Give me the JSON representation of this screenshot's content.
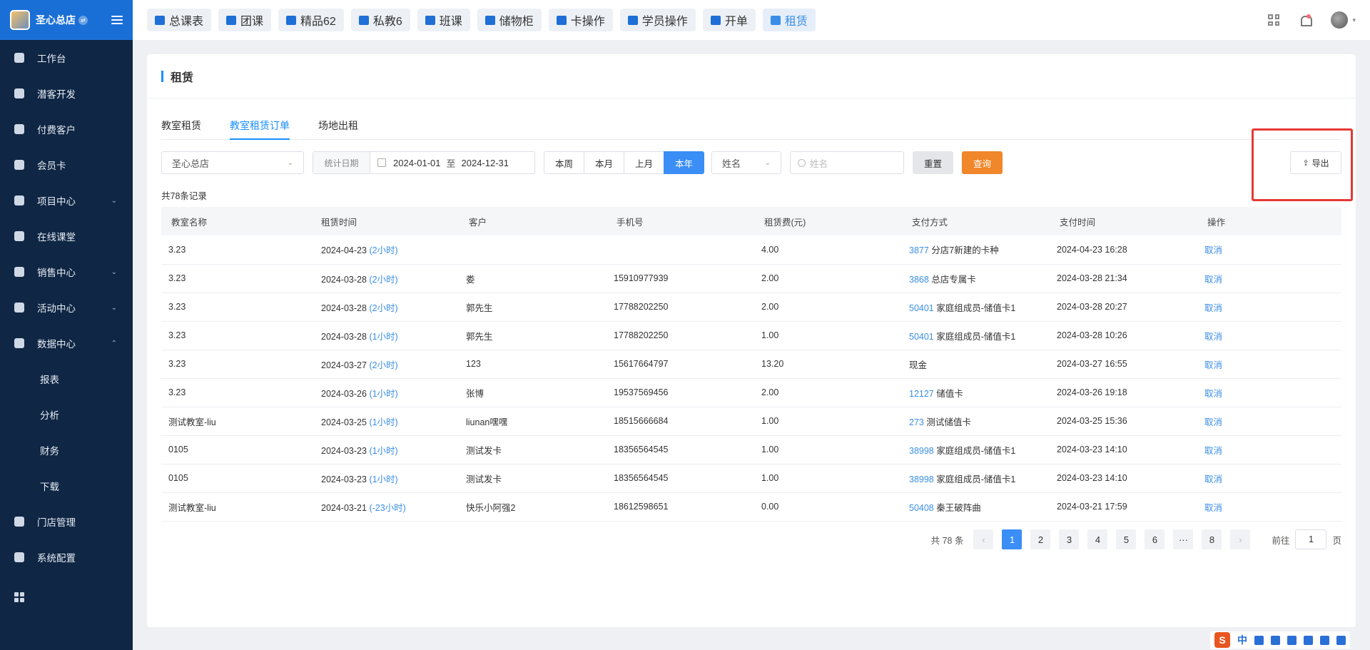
{
  "brand": {
    "name": "圣心总店"
  },
  "sidebar": {
    "items": [
      {
        "label": "工作台",
        "icon": "desktop-icon",
        "arrow": ""
      },
      {
        "label": "潜客开发",
        "icon": "contact-card-icon",
        "arrow": ""
      },
      {
        "label": "付费客户",
        "icon": "users-icon",
        "arrow": ""
      },
      {
        "label": "会员卡",
        "icon": "card-icon",
        "arrow": ""
      },
      {
        "label": "项目中心",
        "icon": "project-icon",
        "arrow": "⌄"
      },
      {
        "label": "在线课堂",
        "icon": "video-icon",
        "arrow": ""
      },
      {
        "label": "销售中心",
        "icon": "tag-icon",
        "arrow": "⌄"
      },
      {
        "label": "活动中心",
        "icon": "gift-icon",
        "arrow": "⌄"
      },
      {
        "label": "数据中心",
        "icon": "pie-chart-icon",
        "arrow": "⌃"
      },
      {
        "label": "报表",
        "sub": true
      },
      {
        "label": "分析",
        "sub": true
      },
      {
        "label": "财务",
        "sub": true
      },
      {
        "label": "下载",
        "sub": true
      },
      {
        "label": "门店管理",
        "icon": "store-icon",
        "arrow": ""
      },
      {
        "label": "系统配置",
        "icon": "settings-icon",
        "arrow": ""
      }
    ]
  },
  "topbar": {
    "tabs": [
      {
        "label": "总课表",
        "icon": "book-icon"
      },
      {
        "label": "团课",
        "icon": "book-icon"
      },
      {
        "label": "精品62",
        "icon": "star-icon"
      },
      {
        "label": "私教6",
        "icon": "users-icon"
      },
      {
        "label": "班课",
        "icon": "board-icon"
      },
      {
        "label": "储物柜",
        "icon": "locker-icon"
      },
      {
        "label": "卡操作",
        "icon": "card-icon"
      },
      {
        "label": "学员操作",
        "icon": "user-icon"
      },
      {
        "label": "开单",
        "icon": "order-icon"
      },
      {
        "label": "租赁",
        "icon": "building-icon",
        "active": true
      }
    ]
  },
  "page": {
    "title": "租赁"
  },
  "subtabs": [
    {
      "label": "教室租赁"
    },
    {
      "label": "教室租赁订单",
      "active": true
    },
    {
      "label": "场地出租"
    }
  ],
  "filters": {
    "store": "圣心总店",
    "date_label": "统计日期",
    "date_start": "2024-01-01",
    "date_sep": "至",
    "date_end": "2024-12-31",
    "periods": [
      "本周",
      "本月",
      "上月",
      "本年"
    ],
    "period_selected": "本年",
    "field_select": "姓名",
    "search_placeholder": "姓名",
    "reset": "重置",
    "query": "查询",
    "export": "导出"
  },
  "record_count": "共78条记录",
  "table": {
    "columns": [
      "教室名称",
      "租赁时间",
      "客户",
      "手机号",
      "租赁费(元)",
      "支付方式",
      "支付时间",
      "操作"
    ],
    "rows": [
      {
        "room": "3.23",
        "date": "2024-04-23",
        "dur": "(2小时)",
        "customer": "",
        "phone": "",
        "fee": "4.00",
        "pay_id": "3877",
        "pay_name": "分店7新建的卡种",
        "pay_time": "2024-04-23 16:28",
        "action": "取消"
      },
      {
        "room": "3.23",
        "date": "2024-03-28",
        "dur": "(2小时)",
        "customer": "娄",
        "phone": "15910977939",
        "fee": "2.00",
        "pay_id": "3868",
        "pay_name": "总店专属卡",
        "pay_time": "2024-03-28 21:34",
        "action": "取消"
      },
      {
        "room": "3.23",
        "date": "2024-03-28",
        "dur": "(2小时)",
        "customer": "郭先生",
        "phone": "17788202250",
        "fee": "2.00",
        "pay_id": "50401",
        "pay_name": "家庭组成员-储值卡1",
        "pay_time": "2024-03-28 20:27",
        "action": "取消"
      },
      {
        "room": "3.23",
        "date": "2024-03-28",
        "dur": "(1小时)",
        "customer": "郭先生",
        "phone": "17788202250",
        "fee": "1.00",
        "pay_id": "50401",
        "pay_name": "家庭组成员-储值卡1",
        "pay_time": "2024-03-28 10:26",
        "action": "取消"
      },
      {
        "room": "3.23",
        "date": "2024-03-27",
        "dur": "(2小时)",
        "customer": "123",
        "phone": "15617664797",
        "fee": "13.20",
        "pay_id": "",
        "pay_name": "现金",
        "pay_time": "2024-03-27 16:55",
        "action": "取消"
      },
      {
        "room": "3.23",
        "date": "2024-03-26",
        "dur": "(1小时)",
        "customer": "张博",
        "phone": "19537569456",
        "fee": "2.00",
        "pay_id": "12127",
        "pay_name": "储值卡",
        "pay_time": "2024-03-26 19:18",
        "action": "取消"
      },
      {
        "room": "测试教室-liu",
        "date": "2024-03-25",
        "dur": "(1小时)",
        "customer": "liunan嘿嘿",
        "phone": "18515666684",
        "fee": "1.00",
        "pay_id": "273",
        "pay_name": "测试储值卡",
        "pay_time": "2024-03-25 15:36",
        "action": "取消"
      },
      {
        "room": "0105",
        "date": "2024-03-23",
        "dur": "(1小时)",
        "customer": "测试发卡",
        "phone": "18356564545",
        "fee": "1.00",
        "pay_id": "38998",
        "pay_name": "家庭组成员-储值卡1",
        "pay_time": "2024-03-23 14:10",
        "action": "取消"
      },
      {
        "room": "0105",
        "date": "2024-03-23",
        "dur": "(1小时)",
        "customer": "测试发卡",
        "phone": "18356564545",
        "fee": "1.00",
        "pay_id": "38998",
        "pay_name": "家庭组成员-储值卡1",
        "pay_time": "2024-03-23 14:10",
        "action": "取消"
      },
      {
        "room": "测试教室-liu",
        "date": "2024-03-21",
        "dur": "(-23小时)",
        "customer": "快乐小阿强2",
        "phone": "18612598651",
        "fee": "0.00",
        "pay_id": "50408",
        "pay_name": "秦王破阵曲",
        "pay_time": "2024-03-21 17:59",
        "action": "取消"
      }
    ]
  },
  "pagination": {
    "total": "共 78 条",
    "prev": "‹",
    "pages": [
      "1",
      "2",
      "3",
      "4",
      "5",
      "6",
      "···",
      "8"
    ],
    "current": "1",
    "next": "›",
    "goto_label": "前往",
    "goto_value": "1",
    "goto_suffix": "页"
  },
  "ime": {
    "logo": "S",
    "mode": "中"
  },
  "colors": {
    "primary": "#1a6fd6",
    "accent_blue": "#3a8ef6",
    "query_orange": "#f0872a",
    "sidebar_bg": "#0f2644",
    "highlight_red": "#e53935"
  }
}
